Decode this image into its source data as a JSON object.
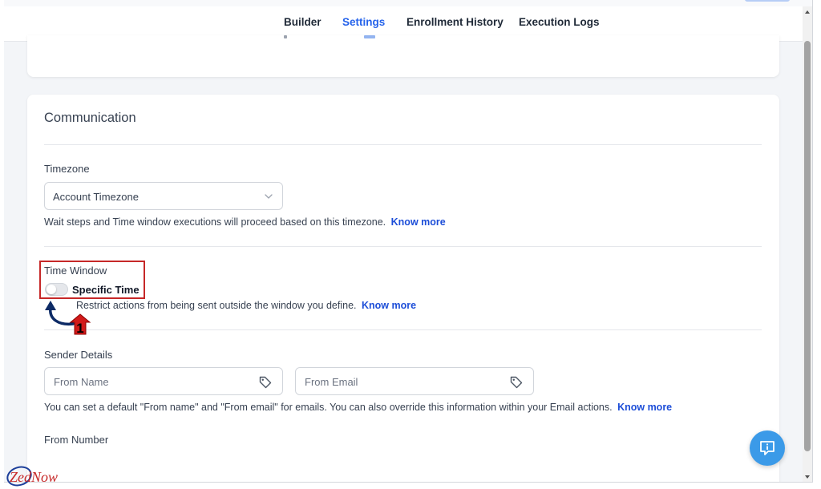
{
  "tabs": [
    {
      "label": "Builder",
      "active": false
    },
    {
      "label": "Settings",
      "active": true
    },
    {
      "label": "Enrollment History",
      "active": false
    },
    {
      "label": "Execution Logs",
      "active": false
    }
  ],
  "communication": {
    "title": "Communication",
    "timezone": {
      "label": "Timezone",
      "value": "Account Timezone",
      "helper": "Wait steps and Time window executions will proceed based on this timezone.",
      "link": "Know more"
    },
    "time_window": {
      "label": "Time Window",
      "toggle_label": "Specific Time",
      "toggle_on": false,
      "helper": "Restrict actions from being sent outside the window you define.",
      "link": "Know more"
    },
    "sender": {
      "label": "Sender Details",
      "from_name_placeholder": "From Name",
      "from_email_placeholder": "From Email",
      "helper": "You can set a default \"From name\" and \"From email\" for emails. You can also override this information within your Email actions.",
      "link": "Know more"
    },
    "from_number": {
      "label": "From Number"
    }
  },
  "annotation": {
    "step_number": "1",
    "color": "#c62828"
  },
  "watermark": {
    "text": "ZedNow"
  },
  "colors": {
    "accent": "#2563eb",
    "link": "#1d4ed8",
    "fab": "#3b9ae8",
    "highlight": "#c62828"
  },
  "icons": [
    "chevron-down-icon",
    "tag-icon",
    "chat-help-icon",
    "curved-arrow-icon"
  ]
}
